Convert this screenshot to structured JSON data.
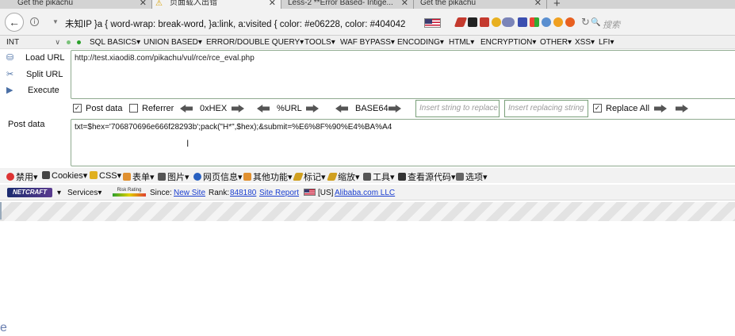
{
  "tabs": [
    {
      "title": "Get the pikachu",
      "active": false
    },
    {
      "title": "页面载入出错",
      "active": true
    },
    {
      "title": "Less-2 **Error Based- Intige...",
      "active": false
    },
    {
      "title": "Get the pikachu",
      "active": false
    }
  ],
  "navbar": {
    "address_text": "未知IP   }a { word-wrap: break-word, }a:link, a:visited { color: #e06228, color: #404042",
    "search_placeholder": "搜索"
  },
  "hackbar": {
    "type_select": "INT",
    "menus": [
      "SQL BASICS▾",
      "UNION BASED▾",
      "ERROR/DOUBLE QUERY▾",
      "TOOLS▾",
      "WAF BYPASS▾",
      "ENCODING▾",
      "HTML▾",
      "ENCRYPTION▾",
      "OTHER▾",
      "XSS▾",
      "LFI▾"
    ],
    "commands": {
      "load": "Load URL",
      "split": "Split URL",
      "execute": "Execute"
    },
    "url_value": "http://test.xiaodi8.com/pikachu/vul/rce/rce_eval.php",
    "post_data_checked": true,
    "post_data_label": "Post data",
    "referrer_checked": false,
    "referrer_label": "Referrer",
    "hex_label": "0xHEX",
    "url_label": "%URL",
    "base64_label": "BASE64",
    "insert_placeholder": "Insert string to replace",
    "replace_placeholder": "Insert replacing string",
    "replace_all_checked": true,
    "replace_all_label": "Replace All",
    "post_label": "Post data",
    "post_value": "txt=$hex='706870696e666f28293b';pack(\"H*\",$hex);&submit=%E6%8F%90%E4%BA%A4"
  },
  "devtoolbar": [
    "禁用▾",
    "Cookies▾",
    "CSS▾",
    "表单▾",
    "图片▾",
    "网页信息▾",
    "其他功能▾",
    "标记▾",
    "缩放▾",
    "工具▾",
    "查看源代码▾",
    "选项▾"
  ],
  "netcraft": {
    "logo": "NETCRAFT",
    "services": "Services▾",
    "risk": "Risk Rating",
    "since_label": "Since:",
    "since_value": "New Site",
    "rank_label": "Rank:",
    "rank_value": "848180",
    "report": "Site Report",
    "country": "[US]",
    "host": "Alibaba.com LLC"
  },
  "colors": {
    "accent_green": "#2aa02a",
    "link": "#1a3ed0"
  }
}
